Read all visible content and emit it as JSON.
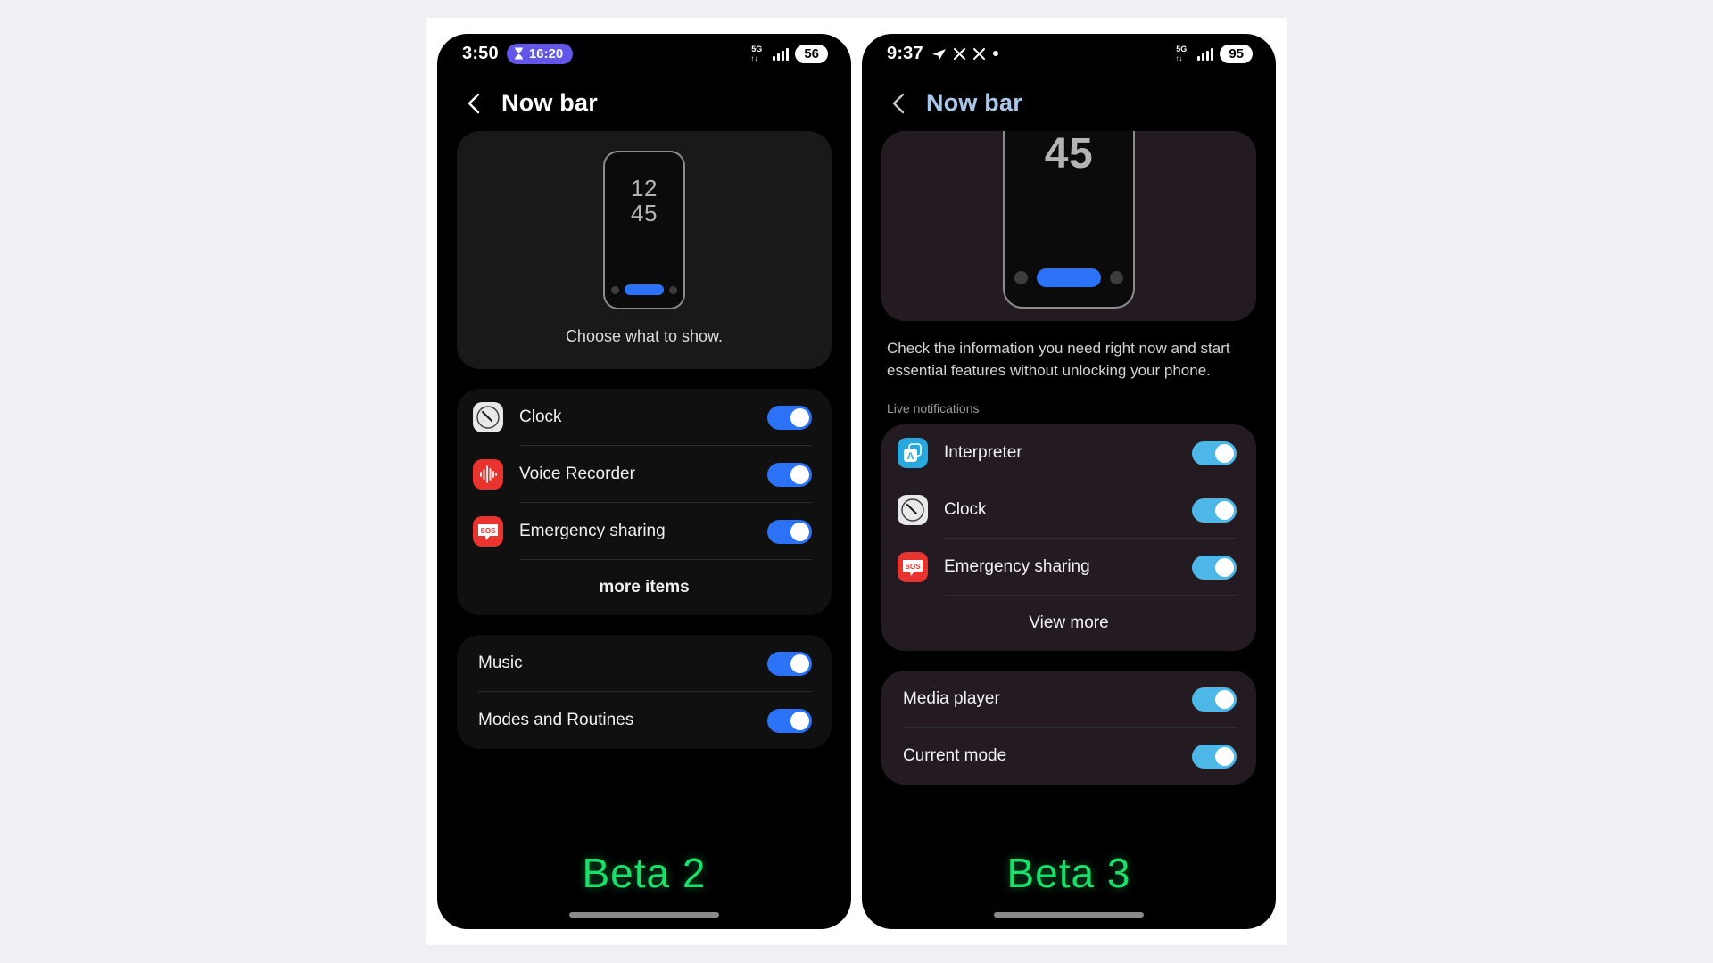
{
  "meta": {
    "background_color": "#f0f0f4",
    "frame_color": "#ffffff",
    "accent_blue": "#2b72f6",
    "accent_cyan": "#4db8e8",
    "beta_green": "#18e06a",
    "pill_purple": "#6257e8"
  },
  "phones": [
    {
      "id": "beta2",
      "status_bar": {
        "time": "3:50",
        "pill": {
          "icon": "hourglass-icon",
          "text": "16:20"
        },
        "network_label": "5G",
        "signal_icon": "signal-bars-icon",
        "battery": "56"
      },
      "appbar": {
        "back_icon": "back-chevron-icon",
        "title": "Now bar",
        "title_color": "#ffffff"
      },
      "preview": {
        "mini_time_top": "12",
        "mini_time_bottom": "45",
        "caption": "Choose what to show."
      },
      "list": [
        {
          "icon": "clock-app-icon",
          "label": "Clock",
          "toggle": "on"
        },
        {
          "icon": "voice-recorder-app-icon",
          "label": "Voice Recorder",
          "toggle": "on"
        },
        {
          "icon": "emergency-sos-app-icon",
          "label": "Emergency sharing",
          "toggle": "on"
        }
      ],
      "more_label": "more items",
      "list2": [
        {
          "label": "Music",
          "toggle": "on"
        },
        {
          "label": "Modes and Routines",
          "toggle": "on"
        }
      ],
      "beta_label": "Beta 2"
    },
    {
      "id": "beta3",
      "status_bar": {
        "time": "9:37",
        "icons": [
          "telegram-send-icon",
          "x-close-icon",
          "x-close-icon",
          "dot-icon"
        ],
        "network_label": "5G",
        "signal_icon": "signal-bars-icon",
        "battery": "95"
      },
      "appbar": {
        "back_icon": "back-chevron-icon",
        "title": "Now bar",
        "title_color": "#a8c7e8"
      },
      "preview": {
        "mini_time_bottom": "45"
      },
      "description": "Check the information you need right now and start essential features without unlocking your phone.",
      "section_label": "Live notifications",
      "list": [
        {
          "icon": "interpreter-app-icon",
          "label": "Interpreter",
          "toggle": "on"
        },
        {
          "icon": "clock-app-icon",
          "label": "Clock",
          "toggle": "on"
        },
        {
          "icon": "emergency-sos-app-icon",
          "label": "Emergency sharing",
          "toggle": "on"
        }
      ],
      "more_label": "View more",
      "list2": [
        {
          "label": "Media player",
          "toggle": "on"
        },
        {
          "label": "Current mode",
          "toggle": "on"
        }
      ],
      "beta_label": "Beta 3"
    }
  ]
}
